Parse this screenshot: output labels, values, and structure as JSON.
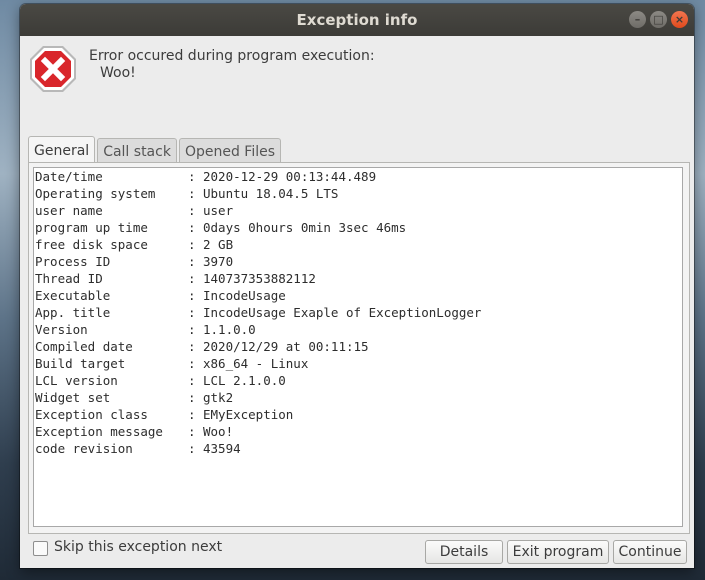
{
  "window": {
    "title": "Exception info"
  },
  "header": {
    "message": "Error occured during program execution:",
    "exception_text": "Woo!"
  },
  "tabs": [
    {
      "label": "General",
      "active": true
    },
    {
      "label": "Call stack",
      "active": false
    },
    {
      "label": "Opened Files",
      "active": false
    }
  ],
  "general": {
    "rows": [
      {
        "label": "Date/time",
        "value": "2020-12-29 00:13:44.489"
      },
      {
        "label": "Operating system",
        "value": "Ubuntu 18.04.5 LTS"
      },
      {
        "label": "user name",
        "value": "user"
      },
      {
        "label": "program up time",
        "value": "0days 0hours 0min 3sec 46ms"
      },
      {
        "label": "free disk space",
        "value": "2 GB"
      },
      {
        "label": "Process ID",
        "value": "3970"
      },
      {
        "label": "Thread ID",
        "value": "140737353882112"
      },
      {
        "label": "Executable",
        "value": "IncodeUsage"
      },
      {
        "label": "App. title",
        "value": "IncodeUsage Exaple of ExceptionLogger"
      },
      {
        "label": "Version",
        "value": "1.1.0.0"
      },
      {
        "label": "Compiled date",
        "value": "2020/12/29 at 00:11:15"
      },
      {
        "label": "Build target",
        "value": "x86_64 - Linux"
      },
      {
        "label": "LCL version",
        "value": "LCL 2.1.0.0"
      },
      {
        "label": "Widget set",
        "value": "gtk2"
      },
      {
        "label": "Exception class",
        "value": "EMyException"
      },
      {
        "label": "Exception message",
        "value": "Woo!"
      },
      {
        "label": "code revision",
        "value": "43594"
      }
    ],
    "separator": ":"
  },
  "footer": {
    "skip_label": "Skip this exception next",
    "skip_checked": false,
    "details_label": "Details",
    "exit_label": "Exit program",
    "continue_label": "Continue"
  },
  "colors": {
    "error_red": "#d9262b",
    "titlebar": "#3c3b37",
    "close_orange": "#df4a1d"
  }
}
